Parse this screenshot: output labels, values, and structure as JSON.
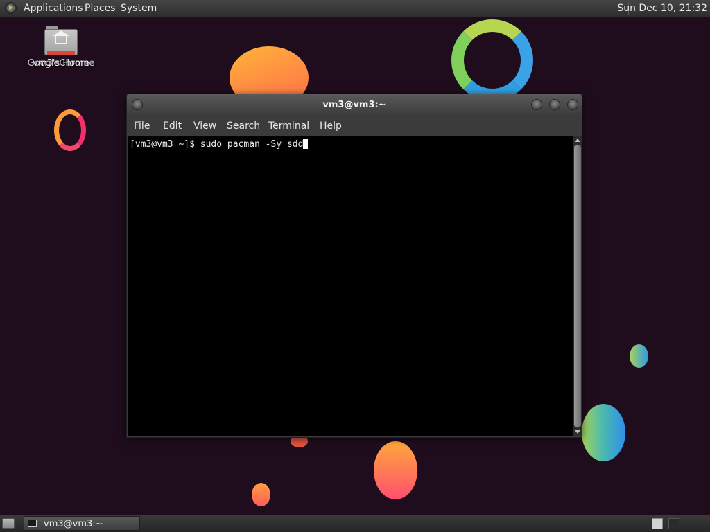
{
  "top_panel": {
    "menus": [
      "Applications",
      "Places",
      "System"
    ],
    "clock": "Sun Dec 10, 21:32",
    "logo_icon": "mint-logo-icon"
  },
  "desktop": {
    "icon": {
      "label": "vm3's Home",
      "overlap_label": "GoogleChrome",
      "icon_name": "home-folder-icon"
    }
  },
  "window": {
    "title": "vm3@vm3:~",
    "menu": [
      "File",
      "Edit",
      "View",
      "Search",
      "Terminal",
      "Help"
    ],
    "terminal": {
      "prompt": "[vm3@vm3 ~]$ ",
      "command": "sudo pacman -Sy sdd"
    }
  },
  "bottom_panel": {
    "task_label": "vm3@vm3:~",
    "task_icon": "terminal-icon",
    "show_desktop_icon": "show-desktop-icon"
  },
  "colors": {
    "desktop_bg": "#1f0d1e",
    "terminal_bg": "#000000",
    "terminal_fg": "#e8e8e8",
    "panel_bg": "#3a3a3a"
  }
}
